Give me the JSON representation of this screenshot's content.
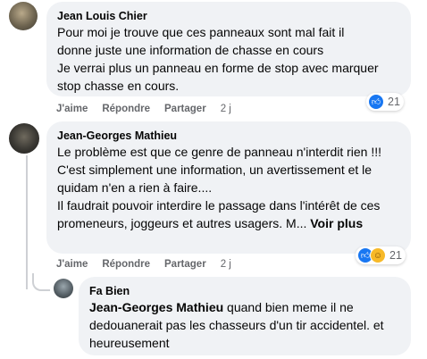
{
  "comments": [
    {
      "author": "Jean Louis Chier",
      "text": "Pour moi je trouve que ces panneaux sont mal fait il donne juste une information de chasse en cours\nJe verrai plus un panneau en forme de stop avec marquer stop chasse en cours.",
      "actions": {
        "like": "J'aime",
        "reply": "Répondre",
        "share": "Partager",
        "time": "2 j"
      },
      "reaction_count": "21",
      "reaction_icons": [
        "like-icon"
      ]
    },
    {
      "author": "Jean-Georges Mathieu",
      "text": "Le problème est que ce genre de panneau n'interdit rien !!! C'est simplement une information, un avertissement et le quidam n'en a rien à faire....\nIl faudrait pouvoir interdire le passage dans l'intérêt de ces promeneurs, joggeurs et autres usagers. M...",
      "see_more": "Voir plus",
      "actions": {
        "like": "J'aime",
        "reply": "Répondre",
        "share": "Partager",
        "time": "2 j"
      },
      "reaction_count": "21",
      "reaction_icons": [
        "like-icon",
        "haha-icon"
      ]
    }
  ],
  "reply": {
    "author": "Fa Bien",
    "mention": "Jean-Georges Mathieu",
    "text": " quand bien meme il ne dedouanerait pas les chasseurs d'un tir accidentel. et heureusement"
  },
  "colors": {
    "bubble": "#f0f2f5",
    "meta_text": "#65676b",
    "like_blue": "#1877f2",
    "haha_yellow": "#f7b928"
  }
}
